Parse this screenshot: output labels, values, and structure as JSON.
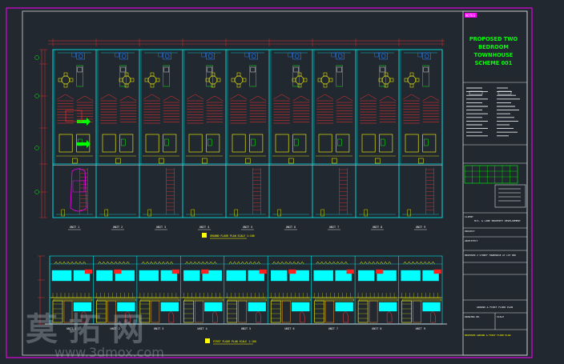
{
  "title_block": {
    "tag": "NOTES",
    "title_lines": [
      "PROPOSED TWO",
      "BEDROOM",
      "TOWNHOUSE",
      "SCHEME 001"
    ],
    "client_label": "M/S. & LINE PROPERTY DEVELOPMENT",
    "project_label": "PROJECT",
    "address_label": "PROPOSED 2 STOREY TOWNHOUSE AT LOT 000",
    "consultant_label": "ARCHITECT",
    "drawing_title": "GROUND & FIRST FLOOR PLAN",
    "drawing_no_label": "DRAWING NO.",
    "scale_label": "SCALE",
    "footer_label": "PROPOSED GROUND & FIRST FLOOR PLAN"
  },
  "plan_caption": "GROUND FLOOR PLAN SCALE 1:100",
  "plan_caption_2": "FIRST FLOOR PLAN SCALE 1:100",
  "units": [
    "UNIT 1",
    "UNIT 2",
    "UNIT 3",
    "UNIT 4",
    "UNIT 5",
    "UNIT 6",
    "UNIT 7",
    "UNIT 8",
    "UNIT 9"
  ],
  "colors": {
    "background": "#212830",
    "frame": "#ff00ff",
    "border": "#ffffff",
    "wall": "#00e5e5",
    "furniture": "#ffff00",
    "stairs": "#ff3030",
    "dims": "#ff3030",
    "grid": "#00ff00",
    "car": "#ff00ff",
    "fixture": "#1e7cff",
    "glass": "#00ffff"
  },
  "watermark": {
    "brand": "莫 拓 网",
    "url": "www.3dmox.com"
  }
}
